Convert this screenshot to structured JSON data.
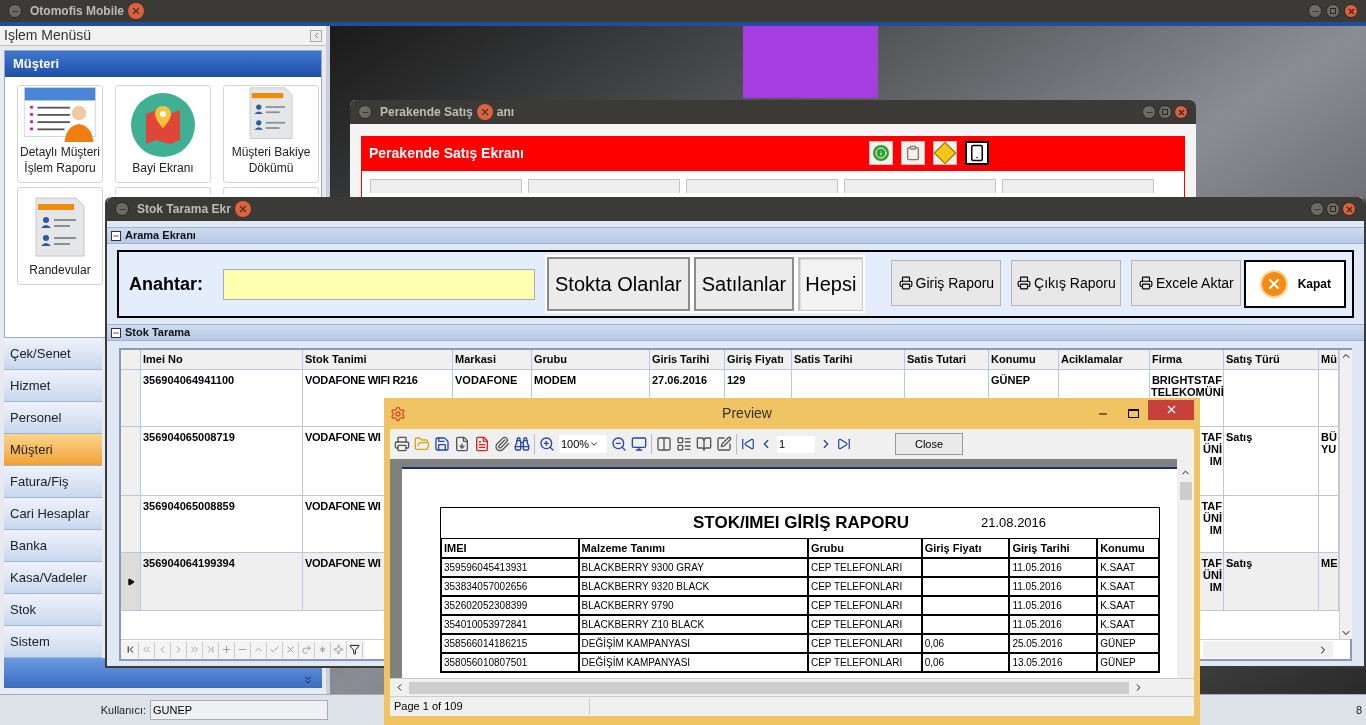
{
  "main_window": {
    "title": "Otomofis Mobile"
  },
  "menu": {
    "title": "Işlem Menüsü",
    "group": "Müşteri",
    "tiles": [
      {
        "label": "Detaylı Müşteri İşlem Raporu",
        "kind": "person-list"
      },
      {
        "label": "Bayi Ekranı",
        "kind": "map"
      },
      {
        "label": "Müşteri Bakiye Dökümü",
        "kind": "document"
      },
      {
        "label": "Randevular",
        "kind": "document"
      },
      {
        "kind": "blank"
      },
      {
        "kind": "blank"
      }
    ],
    "nav": [
      {
        "label": "Çek/Senet",
        "selected": false
      },
      {
        "label": "Hizmet",
        "selected": false
      },
      {
        "label": "Personel",
        "selected": false
      },
      {
        "label": "Müşteri",
        "selected": true
      },
      {
        "label": "Fatura/Fiş",
        "selected": false
      },
      {
        "label": "Cari Hesaplar",
        "selected": false
      },
      {
        "label": "Banka",
        "selected": false
      },
      {
        "label": "Kasa/Vadeler",
        "selected": false
      },
      {
        "label": "Stok",
        "selected": false
      },
      {
        "label": "Sistem",
        "selected": false
      }
    ]
  },
  "perakende_window": {
    "title_start": "Perakende Satış",
    "title_end": "anı",
    "header": "Perakende Satış Ekranı"
  },
  "stok_window": {
    "title": "Stok Tarama Ekr",
    "search_section": "Arama Ekranı",
    "key_label": "Anahtar:",
    "filters": [
      {
        "label": "Stokta Olanlar",
        "selected": false
      },
      {
        "label": "Satılanlar",
        "selected": false
      },
      {
        "label": "Hepsi",
        "selected": true
      }
    ],
    "actions": [
      {
        "label": "Giriş Raporu",
        "kind": "print"
      },
      {
        "label": "Çıkış Raporu",
        "kind": "print"
      },
      {
        "label": "Excele Aktar",
        "kind": "print"
      },
      {
        "label": "Kapat",
        "kind": "close"
      }
    ],
    "grid_section": "Stok Tarama",
    "columns": [
      "Imei No",
      "Stok Tanimi",
      "Markasi",
      "Grubu",
      "Giris Tarihi",
      "Giriş Fiyatı",
      "Satis Tarihi",
      "Satis Tutari",
      "Konumu",
      "Aciklamalar",
      "Firma",
      "Satış Türü",
      "Mü"
    ],
    "rows": [
      {
        "selected": false,
        "cells": [
          "356904064941100",
          "VODAFONE WIFI R216",
          "VODAFONE",
          "MODEM",
          "27.06.2016",
          "129",
          null,
          null,
          "GÜNEP",
          null,
          "BRIGHTSTAF\nTELEKOMÜNİ",
          null,
          null
        ]
      },
      {
        "selected": false,
        "cells": [
          "356904065008719",
          "VODAFONE WI",
          null,
          null,
          null,
          null,
          null,
          null,
          null,
          null,
          "TAF\nÜNİ\nIM",
          "Satış",
          "BÜ\nYU"
        ]
      },
      {
        "selected": false,
        "cells": [
          "356904065008859",
          "VODAFONE WI",
          null,
          null,
          null,
          null,
          null,
          null,
          null,
          null,
          "TAF\nÜNİ\nIM",
          null,
          null
        ]
      },
      {
        "selected": true,
        "cells": [
          "356904064199394",
          "VODAFONE WI",
          null,
          null,
          null,
          null,
          null,
          null,
          null,
          null,
          "TAF\nÜNİ\nIM",
          "Satış",
          "ME"
        ]
      }
    ]
  },
  "preview": {
    "title": "Preview",
    "zoom": "100%",
    "page": "1",
    "close": "Close",
    "status": "Page 1 of 109",
    "report": {
      "title": "STOK/IMEI GİRİŞ RAPORU",
      "date": "21.08.2016",
      "columns": [
        "IMEI",
        "Malzeme Tanımı",
        "Grubu",
        "Giriş Fiyatı",
        "Giriş Tarihi",
        "Konumu"
      ],
      "rows": [
        [
          "359596045413931",
          "BLACKBERRY 9300 GRAY",
          "CEP TELEFONLARI",
          null,
          "11.05.2016",
          "K.SAAT"
        ],
        [
          "353834057002656",
          "BLACKBERRY 9320 BLACK",
          "CEP TELEFONLARI",
          null,
          "11.05.2016",
          "K.SAAT"
        ],
        [
          "352602052308399",
          "BLACKBERRY 9790",
          "CEP TELEFONLARI",
          null,
          "11.05.2016",
          "K.SAAT"
        ],
        [
          "354010053972841",
          "BLACKBERRY Z10 BLACK",
          "CEP TELEFONLARI",
          null,
          "11.05.2016",
          "K.SAAT"
        ],
        [
          "358566014186215",
          "DEĞİŞİM KAMPANYASI",
          "CEP TELEFONLARI",
          "0,06",
          "25.05.2016",
          "GÜNEP"
        ],
        [
          "358056010807501",
          "DEĞİŞİM KAMPANYASI",
          "CEP TELEFONLARI",
          "0,06",
          "13.05.2016",
          "GÜNEP"
        ]
      ]
    }
  },
  "status_bar": {
    "user_label": "Kullanıcı:",
    "user": "GUNEP",
    "right_text": "8"
  }
}
